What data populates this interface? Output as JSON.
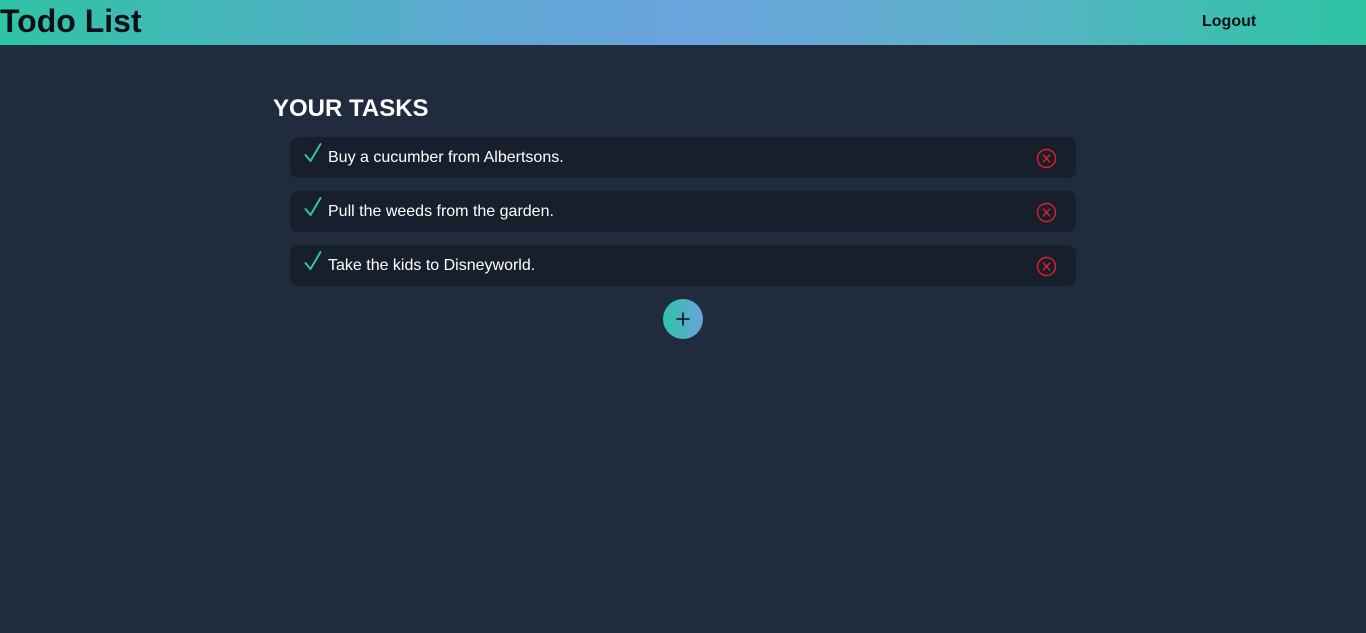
{
  "header": {
    "title": "Todo List",
    "logout_label": "Logout"
  },
  "main": {
    "heading": "YOUR TASKS",
    "tasks": [
      {
        "text": "Buy a cucumber from Albertsons."
      },
      {
        "text": "Pull the weeds from the garden."
      },
      {
        "text": "Take the kids to Disneyworld."
      }
    ]
  },
  "icons": {
    "check": "check-icon",
    "delete": "close-circle-icon",
    "add": "plus-icon"
  },
  "colors": {
    "background": "#212b3e",
    "card": "#181f2c",
    "check": "#2ec4a4",
    "delete": "#e0202a",
    "accent_start": "#2ec4a4",
    "accent_end": "#6aa3de"
  }
}
